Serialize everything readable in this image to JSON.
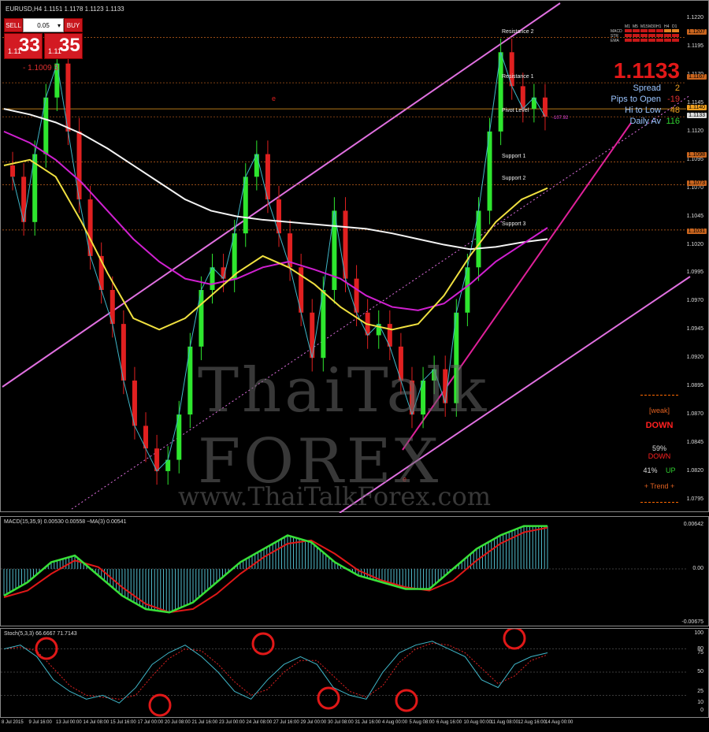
{
  "chart": {
    "title": "EURUSD,H4  1.1151 1.1178 1.1123 1.1133",
    "watermark_brand": "ThaiTalk FOREX",
    "watermark_url": "www.ThaiTalkForex.com",
    "price_top_label": "- 1.1009 3"
  },
  "trade_panel": {
    "sell": "SELL",
    "buy": "BUY",
    "lot": "0.05",
    "lot_arrow": "▾",
    "bid_small": "1.11",
    "bid_big": "33",
    "ask_small": "1.11",
    "ask_big": "35"
  },
  "info": {
    "price": "1.1133",
    "rows": [
      {
        "k": "Spread",
        "v": "2",
        "color": "#f0a020"
      },
      {
        "k": "Pips to Open",
        "v": "-19",
        "color": "#e03030"
      },
      {
        "k": "Hi to Low",
        "v": "48",
        "color": "#f0a020"
      },
      {
        "k": "Daily Av",
        "v": "116",
        "color": "#30d030"
      }
    ],
    "timeframes": [
      "M1",
      "M5",
      "M15",
      "M30",
      "H1",
      "H4",
      "D1"
    ],
    "indicators": [
      "MACD",
      "STR",
      "EMA"
    ]
  },
  "trend": {
    "strength": "[weak]",
    "direction": "DOWN",
    "down_pct": "59%",
    "down_label": "DOWN",
    "up_pct": "41%",
    "up_label": "UP",
    "trend_label": "+  Trend  +"
  },
  "levels": [
    {
      "name": "Resistance 2",
      "price": 1.1203
    },
    {
      "name": "Resistance 1",
      "price": 1.1163
    },
    {
      "name": "Pivot Level",
      "price": 1.1133
    },
    {
      "name": "Support 1",
      "price": 1.1093
    },
    {
      "name": "Support 2",
      "price": 1.1073
    },
    {
      "name": "Support 3",
      "price": 1.1033
    }
  ],
  "price_axis": [
    "1.1220",
    "1.1195",
    "1.1170",
    "1.1145",
    "1.1120",
    "1.1095",
    "1.1070",
    "1.1045",
    "1.1020",
    "1.0995",
    "1.0970",
    "1.0945",
    "1.0920",
    "1.0895",
    "1.0870",
    "1.0845",
    "1.0820",
    "1.0795"
  ],
  "price_tags": [
    {
      "text": "1.1207",
      "price": 1.1207,
      "bg": "#c8641e"
    },
    {
      "text": "1.1167",
      "price": 1.1167,
      "bg": "#c8641e"
    },
    {
      "text": "1.1140",
      "price": 1.114,
      "bg": "#f0a020"
    },
    {
      "text": "1.1133",
      "price": 1.1133,
      "bg": "#dddddd"
    },
    {
      "text": "1.1098",
      "price": 1.1098,
      "bg": "#c8641e"
    },
    {
      "text": "1.1073",
      "price": 1.1073,
      "bg": "#c8641e"
    },
    {
      "text": "1.1031",
      "price": 1.1031,
      "bg": "#c8641e"
    }
  ],
  "pivot_marker": "-107.92",
  "macd": {
    "title": "MACD(15,35,9) 0.00530 0.00558 ~MA(3) 0.00541",
    "axis": [
      "0.00642",
      "0.00",
      "-0.00675"
    ]
  },
  "stoch": {
    "title": "Stoch(5,3,3) 66.6667 71.7143",
    "axis": [
      "100",
      "80",
      "75",
      "50",
      "25",
      "10",
      "0"
    ]
  },
  "dates": [
    "8 Jul 2015",
    "9 Jul 16:00",
    "13 Jul 00:00",
    "14 Jul 08:00",
    "15 Jul 16:00",
    "17 Jul 00:00",
    "20 Jul 08:00",
    "21 Jul 16:00",
    "23 Jul 00:00",
    "24 Jul 08:00",
    "27 Jul 16:00",
    "29 Jul 00:00",
    "30 Jul 08:00",
    "31 Jul 16:00",
    "4 Aug 00:00",
    "5 Aug 08:00",
    "6 Aug 16:00",
    "10 Aug 00:00",
    "11 Aug 08:00",
    "12 Aug 16:00",
    "14 Aug 00:00"
  ],
  "chart_data": {
    "type": "candlestick",
    "symbol": "EURUSD",
    "timeframe": "H4",
    "ylim": [
      1.079,
      1.1225
    ],
    "close_series": [
      1.108,
      1.104,
      1.11,
      1.115,
      1.118,
      1.112,
      1.106,
      1.101,
      1.098,
      1.095,
      1.09,
      1.086,
      1.084,
      1.082,
      1.083,
      1.087,
      1.093,
      1.098,
      1.1,
      1.099,
      1.103,
      1.108,
      1.11,
      1.106,
      1.103,
      1.1,
      1.096,
      1.092,
      1.098,
      1.105,
      1.099,
      1.096,
      1.094,
      1.095,
      1.093,
      1.09,
      1.087,
      1.09,
      1.091,
      1.088,
      1.096,
      1.1,
      1.105,
      1.112,
      1.119,
      1.116,
      1.114,
      1.115,
      1.1133
    ],
    "ema_white": [
      1.114,
      1.1135,
      1.1128,
      1.1118,
      1.1105,
      1.109,
      1.1075,
      1.106,
      1.105,
      1.1045,
      1.1042,
      1.104,
      1.1038,
      1.1036,
      1.1034,
      1.103,
      1.1025,
      1.102,
      1.1016,
      1.1018,
      1.1022,
      1.1025
    ],
    "ema_magenta": [
      1.112,
      1.111,
      1.1095,
      1.1075,
      1.105,
      1.1025,
      1.1005,
      1.099,
      1.0985,
      1.099,
      1.1,
      1.1005,
      1.0998,
      1.099,
      1.0975,
      1.0965,
      1.0962,
      1.0968,
      1.0985,
      1.1005,
      1.102,
      1.1035
    ],
    "ema_yellow": [
      1.109,
      1.1095,
      1.108,
      1.104,
      1.0995,
      1.0955,
      1.0945,
      1.0955,
      1.0975,
      1.0995,
      1.101,
      1.1,
      1.0985,
      1.0965,
      1.095,
      1.0945,
      1.095,
      1.0975,
      1.101,
      1.104,
      1.106,
      1.107
    ],
    "macd_hist": [
      -0.004,
      -0.002,
      0.001,
      0.002,
      -0.001,
      -0.004,
      -0.006,
      -0.0065,
      -0.005,
      -0.002,
      0.001,
      0.003,
      0.005,
      0.004,
      0.001,
      -0.001,
      -0.002,
      -0.003,
      -0.003,
      0.0,
      0.003,
      0.005,
      0.0064,
      0.0064
    ],
    "stoch_main": [
      80,
      85,
      70,
      40,
      25,
      15,
      20,
      10,
      30,
      60,
      75,
      85,
      70,
      50,
      25,
      15,
      40,
      60,
      70,
      60,
      30,
      20,
      15,
      50,
      75,
      85,
      90,
      80,
      70,
      40,
      30,
      60,
      70,
      75
    ]
  }
}
